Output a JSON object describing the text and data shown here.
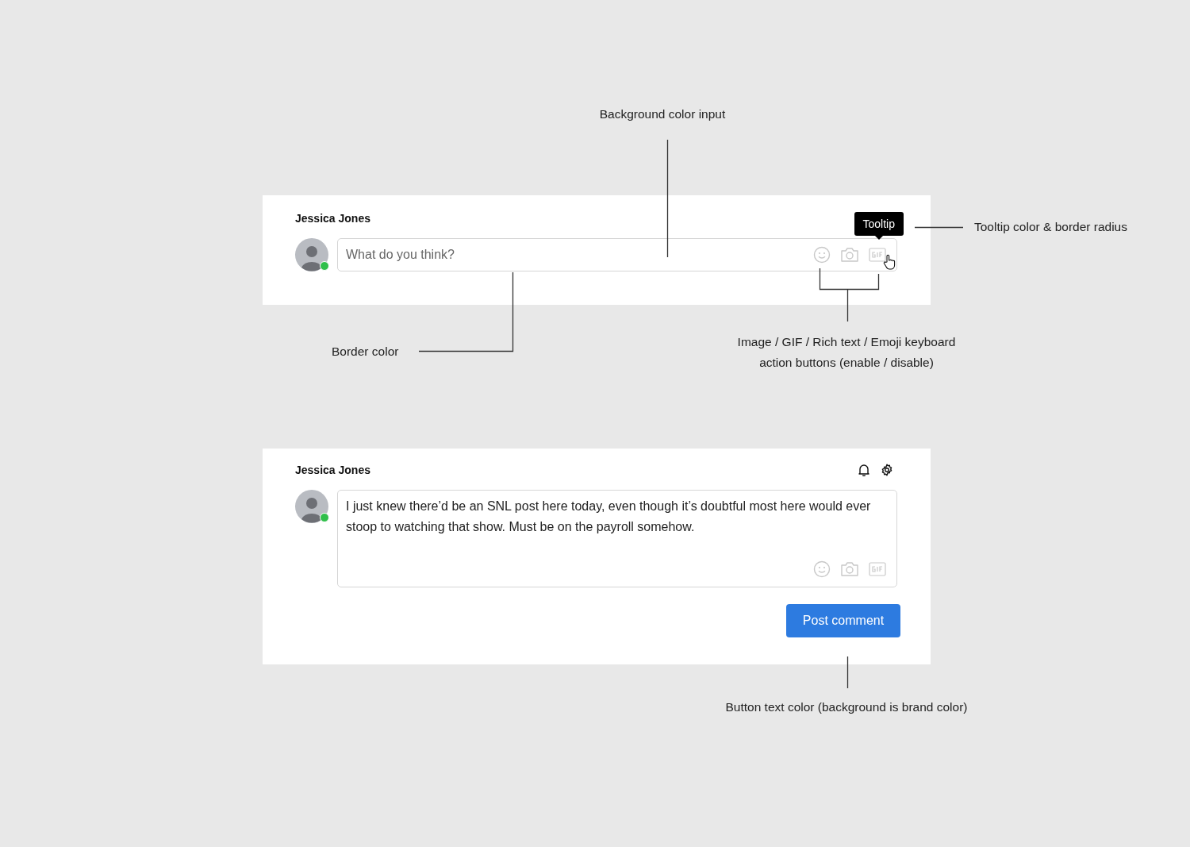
{
  "cards": [
    {
      "user_name": "Jessica Jones",
      "online": true,
      "placeholder": "What do you think?",
      "tooltip": "Tooltip"
    },
    {
      "user_name": "Jessica Jones",
      "online": true,
      "value": "I just knew there’d be an SNL post here today, even though it’s doubtful most here would ever stoop to watching that show. Must be on the payroll somehow.",
      "header_icons": true,
      "button": "Post comment"
    }
  ],
  "annotations": [
    {
      "lines": [
        "Background color input"
      ]
    },
    {
      "lines": [
        "Tooltip color & border radius"
      ]
    },
    {
      "lines": [
        "Border color"
      ]
    },
    {
      "lines": [
        "Image / GIF / Rich text  / Emoji keyboard",
        "action buttons (enable / disable)"
      ]
    },
    {
      "lines": [
        "Button text color (background is brand color)"
      ]
    }
  ]
}
